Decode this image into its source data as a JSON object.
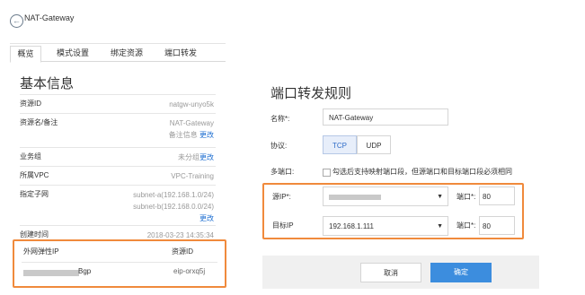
{
  "header": {
    "title": "NAT-Gateway"
  },
  "tabs": [
    "概览",
    "模式设置",
    "绑定资源",
    "端口转发"
  ],
  "section_title": "基本信息",
  "info_rows": [
    {
      "key": "资源ID",
      "value": "natgw-unyo5k"
    },
    {
      "key": "资源名/备注",
      "value": "NAT-Gateway",
      "value2": "备注信息",
      "link": "更改"
    },
    {
      "key": "业务组",
      "value": "未分组",
      "link": "更改"
    },
    {
      "key": "所属VPC",
      "value": "VPC-Training"
    },
    {
      "key": "指定子网",
      "value": "subnet-a(192.168.1.0/24)",
      "value2": "subnet-b(192.168.0.0/24)",
      "link": "更改"
    },
    {
      "key": "创建时间",
      "value": "2018-03-23 14:35:34"
    }
  ],
  "eip": {
    "col1": "外网弹性IP",
    "col2": "资源ID",
    "ip_suffix": "Bgp",
    "resource_id": "eip-orxq5j"
  },
  "dialog": {
    "title": "端口转发规则",
    "name_label": "名称*:",
    "name_value": "NAT-Gateway",
    "protocol_label": "协议:",
    "tcp": "TCP",
    "udp": "UDP",
    "multiport_label": "多端口:",
    "multiport_text": "勾选后支持映射端口段，但源端口和目标端口段必须相同",
    "src_ip_label": "源IP*:",
    "src_port_label": "端口*:",
    "src_port_value": "80",
    "dst_ip_label": "目标IP",
    "dst_ip_value": "192.168.1.111",
    "dst_port_label": "端口*:",
    "dst_port_value": "80",
    "cancel": "取消",
    "ok": "确定"
  },
  "colors": {
    "highlight": "#f08a3c",
    "primary": "#3c8dde",
    "link": "#1f6fd1"
  }
}
